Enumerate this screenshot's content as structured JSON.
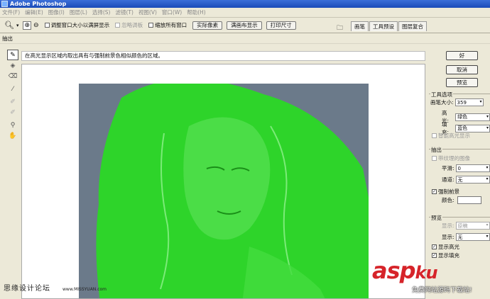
{
  "window": {
    "title": "Adobe Photoshop"
  },
  "menu": [
    "文件(F)",
    "编辑(E)",
    "图像(I)",
    "图层(L)",
    "选择(S)",
    "滤镜(T)",
    "视图(V)",
    "窗口(W)",
    "帮助(H)"
  ],
  "options_bar": {
    "checkbox_fit": "调整窗口大小以满屏显示",
    "checkbox_ignore": "忽略调板",
    "checkbox_zoom_all": "缩放所有窗口",
    "btn_actual": "实际像素",
    "btn_fit": "满画布显示",
    "btn_print": "打印尺寸"
  },
  "palette_tabs": [
    "画笔",
    "工具预设",
    "图层复合"
  ],
  "dialog": {
    "title": "抽出",
    "hint": "在高光显示区域内取出具有与强制前景色相似颜色的区域。",
    "buttons": {
      "ok": "好",
      "cancel": "取消",
      "preview": "预览"
    },
    "tool_options": {
      "label": "工具选项",
      "brush_size_label": "画笔大小:",
      "brush_size": "359",
      "highlight_label": "高光:",
      "highlight": "绿色",
      "fill_label": "填充:",
      "fill": "蓝色",
      "smart_highlight": "智能高光显示"
    },
    "extraction": {
      "label": "抽出",
      "textured": "带纹理的图像",
      "smooth_label": "平滑:",
      "smooth": "0",
      "channel_label": "通道:",
      "channel": "无",
      "force_fg": "强制前景",
      "color_label": "颜色:"
    },
    "preview_group": {
      "label": "预览",
      "show_label": "显示:",
      "show": "原稿",
      "display_label": "显示:",
      "display": "无",
      "show_highlight": "显示高光",
      "show_fill": "显示填充"
    }
  },
  "watermarks": {
    "left": "思缘设计论坛",
    "left_url": "www.MISSYUAN.com",
    "asp": "asp",
    "ku": "ku",
    "sub": "免费网站源码下载站!"
  },
  "colors": {
    "highlight_green": "#2ed42a",
    "background": "#6b7a8a"
  }
}
